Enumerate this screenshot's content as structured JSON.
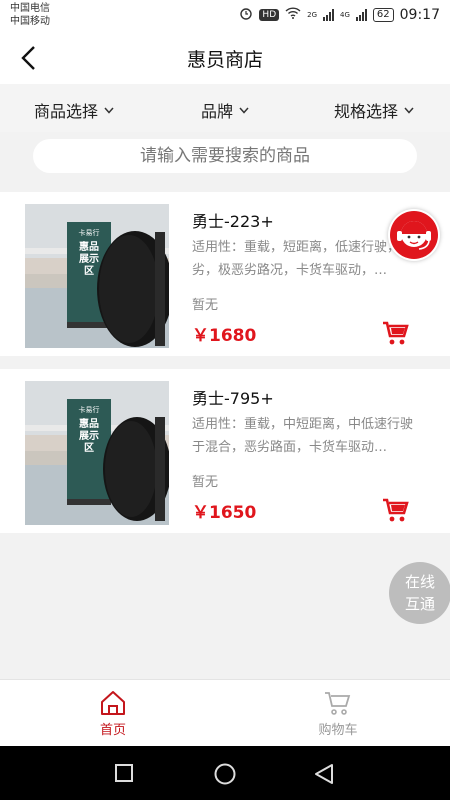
{
  "status_bar": {
    "carrier1": "中国电信",
    "carrier2": "中国移动",
    "hd": "HD",
    "net1": "2G",
    "net2": "4G",
    "battery": "62",
    "time": "09:17"
  },
  "nav": {
    "title": "惠员商店",
    "back_icon": "chevron-left-icon"
  },
  "filters": [
    {
      "label": "商品选择"
    },
    {
      "label": "品牌"
    },
    {
      "label": "规格选择"
    }
  ],
  "search": {
    "placeholder": "请输入需要搜索的商品"
  },
  "products": [
    {
      "name": "勇士-223+",
      "desc": "适用性：重载，短距离，低速行驶，恶劣，极恶劣路况，卡货车驱动，…",
      "stock": "暂无",
      "price": "￥1680",
      "image_sign_top": "卡易行",
      "image_sign_main": "惠品展示区"
    },
    {
      "name": "勇士-795+",
      "desc": "适用性：重载，中短距离，中低速行驶于混合，恶劣路面，卡货车驱动…",
      "stock": "暂无",
      "price": "￥1650",
      "image_sign_top": "卡易行",
      "image_sign_main": "惠品展示区"
    }
  ],
  "floating": {
    "online_chat_line1": "在线",
    "online_chat_line2": "互通",
    "cs_icon": "customer-service-icon"
  },
  "tabbar": [
    {
      "label": "首页",
      "icon": "home-icon",
      "active": true
    },
    {
      "label": "购物车",
      "icon": "cart-icon",
      "active": false
    }
  ],
  "colors": {
    "accent": "#e0161d",
    "tab_active": "#c4161c",
    "tab_inactive": "#999999"
  }
}
